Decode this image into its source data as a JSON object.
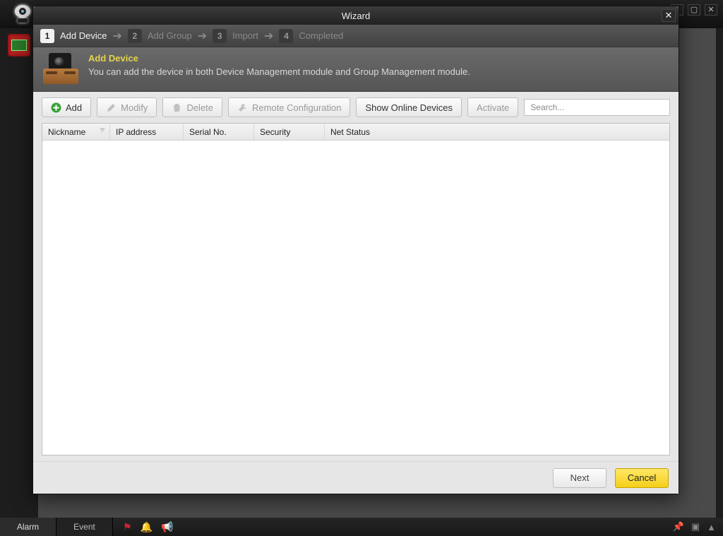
{
  "window": {
    "title": "Wizard"
  },
  "steps": {
    "s1": {
      "num": "1",
      "label": "Add Device"
    },
    "s2": {
      "num": "2",
      "label": "Add Group"
    },
    "s3": {
      "num": "3",
      "label": "Import"
    },
    "s4": {
      "num": "4",
      "label": "Completed"
    }
  },
  "header": {
    "title": "Add Device",
    "desc": "You can add the device in both Device Management module and Group Management module."
  },
  "toolbar": {
    "add": "Add",
    "modify": "Modify",
    "delete": "Delete",
    "remote": "Remote Configuration",
    "show": "Show Online Devices",
    "activate": "Activate"
  },
  "search": {
    "placeholder": "Search..."
  },
  "columns": {
    "nickname": "Nickname",
    "ip": "IP address",
    "serial": "Serial No.",
    "security": "Security",
    "netstatus": "Net Status"
  },
  "footer": {
    "next": "Next",
    "cancel": "Cancel"
  },
  "bottombar": {
    "alarm": "Alarm",
    "event": "Event"
  }
}
